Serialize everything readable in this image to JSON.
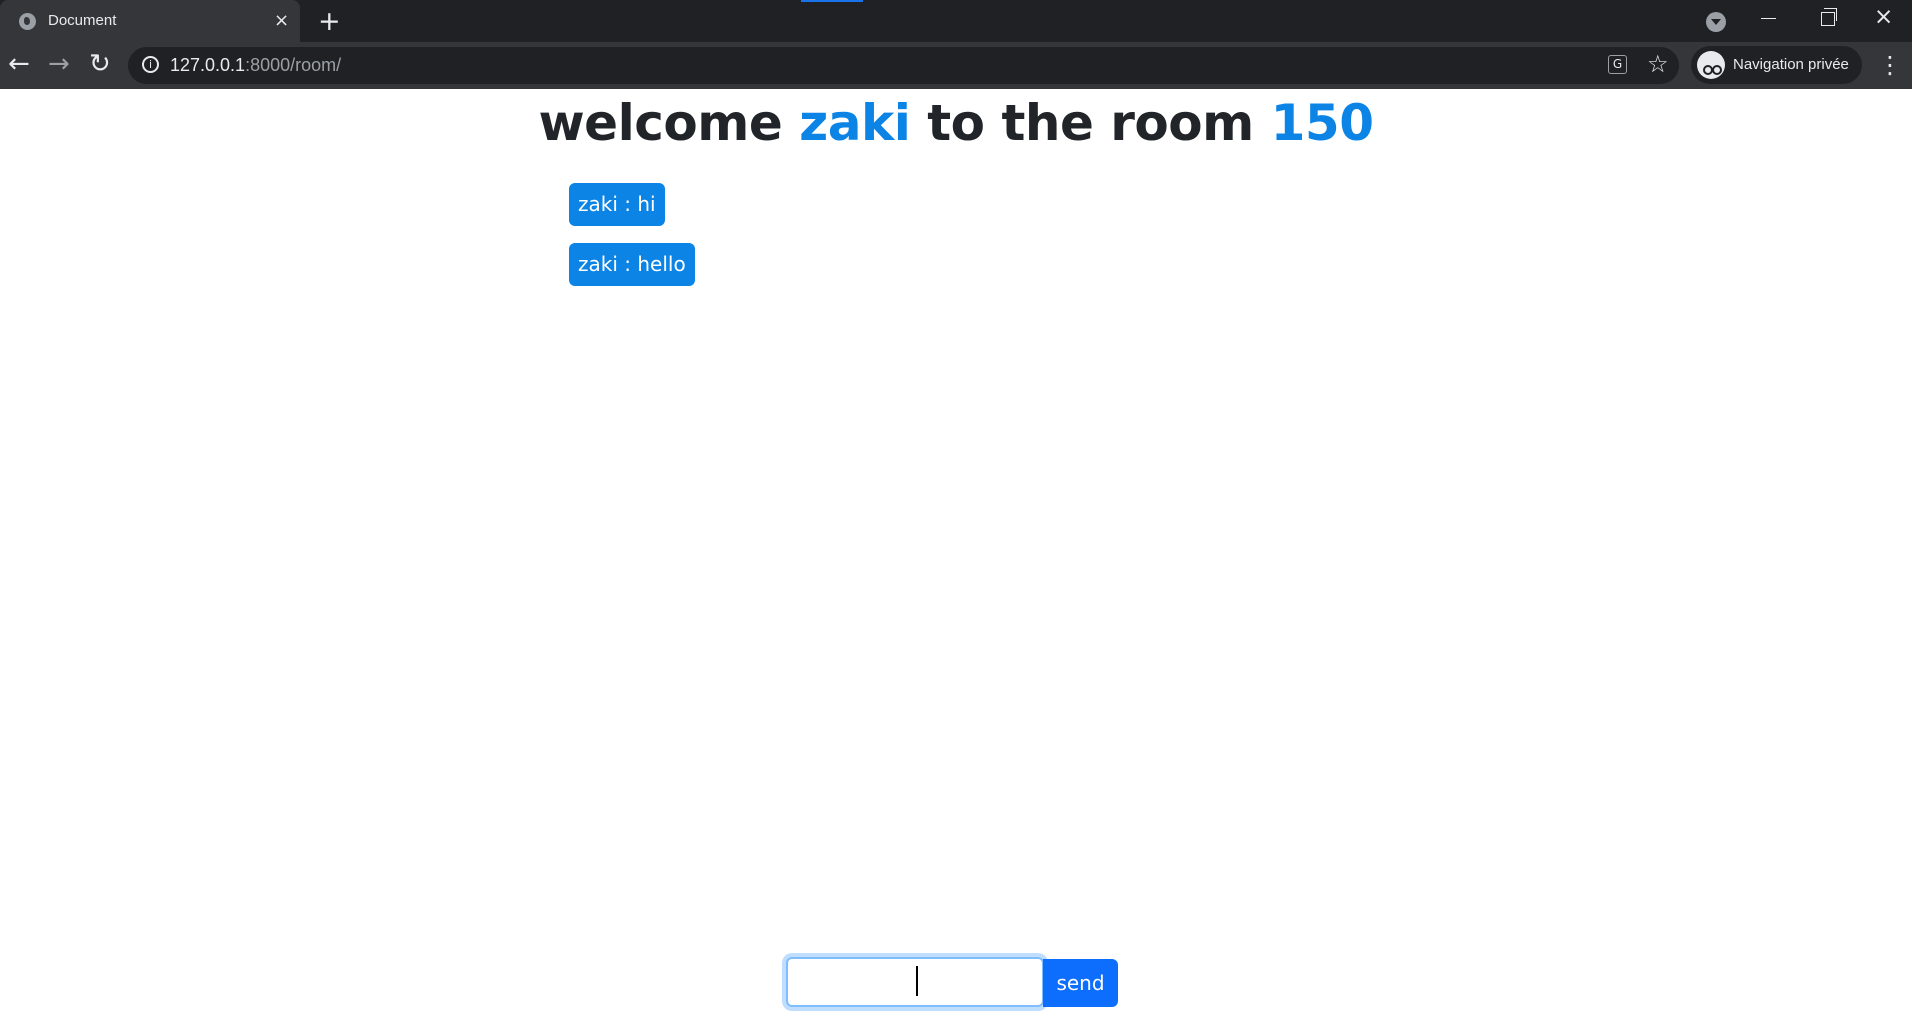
{
  "browser": {
    "tab_title": "Document",
    "tab_close": "×",
    "new_tab": "+",
    "url_host": "127.0.0.1",
    "url_path": ":8000/room/",
    "profile_label": "Navigation privée",
    "icons": [
      "globe-icon",
      "close-icon",
      "plus-icon",
      "tab-search-icon",
      "minimize-icon",
      "restore-icon",
      "window-close-icon",
      "back-icon",
      "forward-icon",
      "reload-icon",
      "site-info-icon",
      "translate-icon",
      "star-icon",
      "incognito-icon",
      "menu-icon"
    ]
  },
  "page": {
    "heading_prefix": "welcome ",
    "username": "zaki",
    "heading_middle": " to the room ",
    "room_number": "150",
    "messages": [
      "zaki : hi",
      "zaki : hello"
    ],
    "input_value": "",
    "send_label": "send",
    "accent_color": "#0b84e6",
    "button_color": "#0d6efd"
  }
}
